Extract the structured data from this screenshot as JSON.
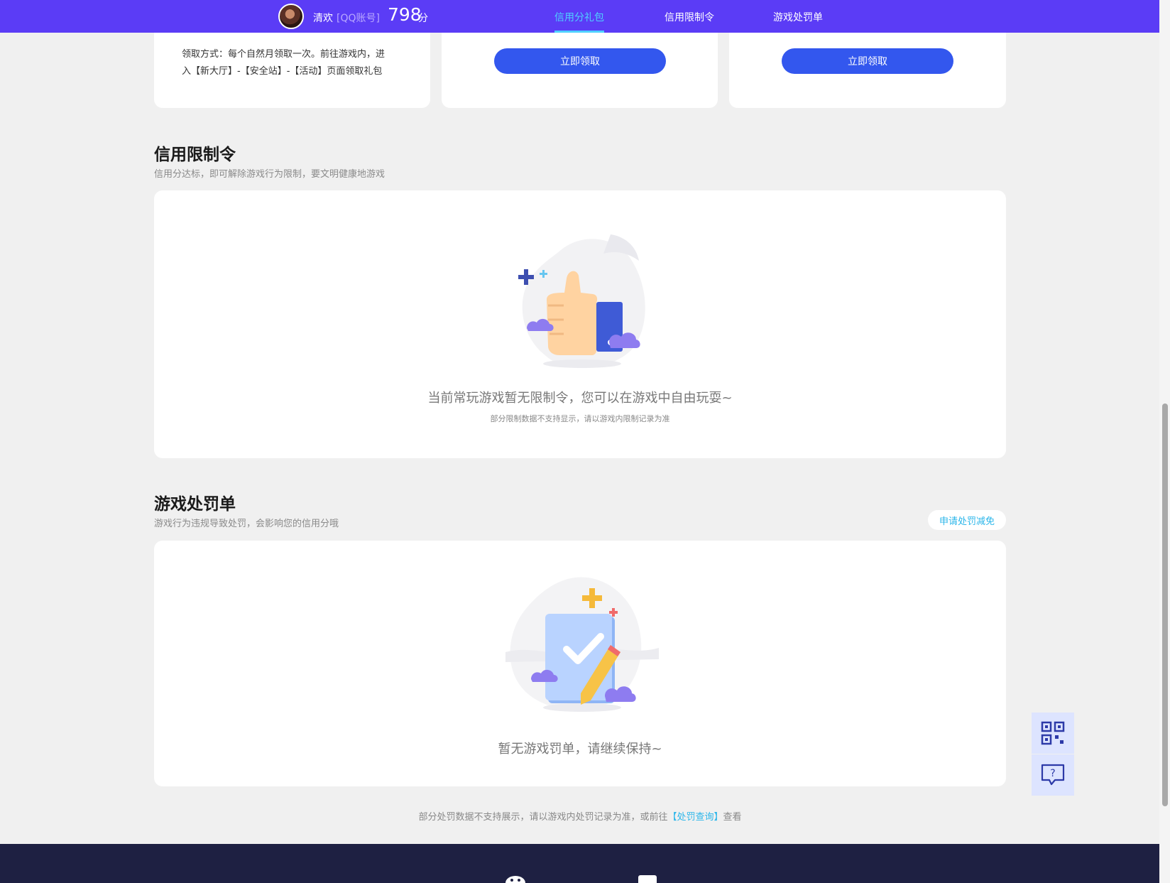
{
  "header": {
    "user_name": "清欢",
    "account_type": "[QQ账号]",
    "score": "798",
    "score_unit": "分",
    "tabs": [
      {
        "label": "信用分礼包",
        "active": true
      },
      {
        "label": "信用限制令",
        "active": false
      },
      {
        "label": "游戏处罚单",
        "active": false
      }
    ]
  },
  "gift": {
    "desc_line1": "领取方式：每个自然月领取一次。前往游戏内，进",
    "desc_line2": "入【新大厅】-【安全站】-【活动】页面领取礼包",
    "claim_label": "立即领取"
  },
  "restriction": {
    "title": "信用限制令",
    "subtitle": "信用分达标，即可解除游戏行为限制，要文明健康地游戏",
    "empty_main": "当前常玩游戏暂无限制令，您可以在游戏中自由玩耍~",
    "empty_sub": "部分限制数据不支持显示，请以游戏内限制记录为准"
  },
  "penalty": {
    "title": "游戏处罚单",
    "subtitle": "游戏行为违规导致处罚，会影响您的信用分哦",
    "appeal_label": "申请处罚减免",
    "empty_main": "暂无游戏罚单，请继续保持~",
    "footnote_pre": "部分处罚数据不支持展示，请以游戏内处罚记录为准，或前往",
    "footnote_link": "【处罚查询】",
    "footnote_post": "查看"
  },
  "icons": [
    "qrcode-icon",
    "help-chat-icon",
    "wechat-icon",
    "thumbs-up-illustration",
    "checklist-pencil-illustration"
  ],
  "colors": {
    "header_bg": "#5b3cf6",
    "active_tab": "#4fd0ff",
    "button": "#3357ee",
    "link": "#2bb6ea",
    "footer": "#1e2042"
  }
}
